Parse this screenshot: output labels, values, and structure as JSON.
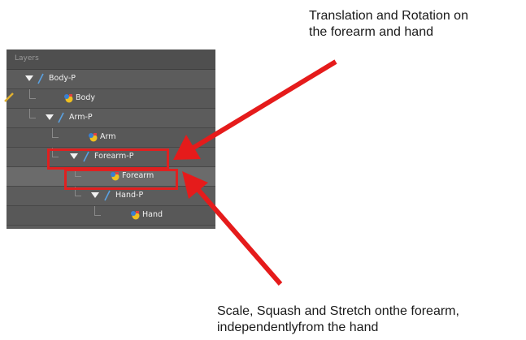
{
  "panel": {
    "title": "Layers",
    "layers": [
      {
        "name": "Body-P",
        "kind": "peg"
      },
      {
        "name": "Body",
        "kind": "drawing"
      },
      {
        "name": "Arm-P",
        "kind": "peg"
      },
      {
        "name": "Arm",
        "kind": "drawing"
      },
      {
        "name": "Forearm-P",
        "kind": "peg"
      },
      {
        "name": "Forearm",
        "kind": "drawing"
      },
      {
        "name": "Hand-P",
        "kind": "peg"
      },
      {
        "name": "Hand",
        "kind": "drawing"
      }
    ]
  },
  "annotations": {
    "top_line1": "Translation and Rotation on",
    "top_line2": "the forearm and hand",
    "bottom_line1": "Scale, Squash and Stretch onthe forearm,",
    "bottom_line2": "independentlyfrom the hand"
  },
  "colors": {
    "highlight": "#e02020",
    "panel_bg": "#5c5c5c",
    "peg_icon": "#5aa0e0"
  }
}
